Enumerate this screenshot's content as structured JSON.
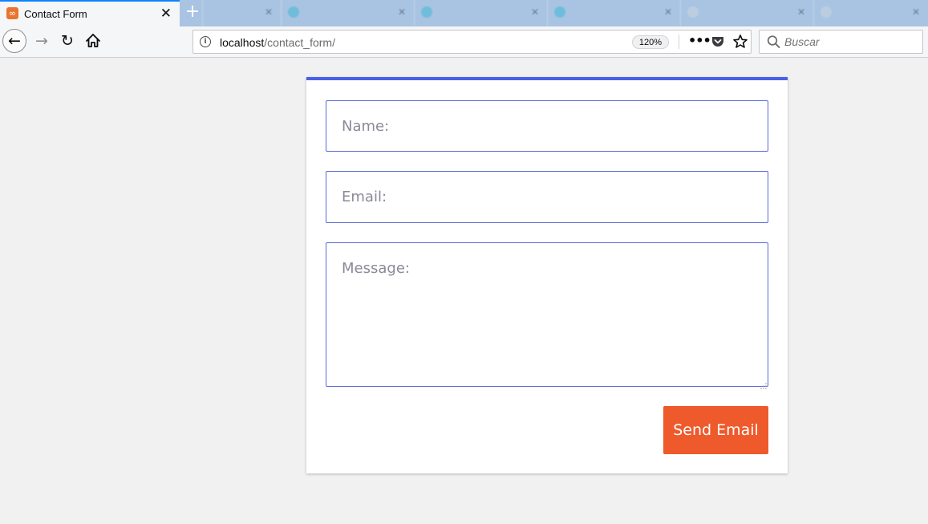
{
  "browser": {
    "active_tab": {
      "title": "Contact Form",
      "favicon": "xampp-icon"
    },
    "new_tab_icon": "plus-icon",
    "close_icon": "close-icon",
    "url": {
      "host": "localhost",
      "path": "/contact_form/"
    },
    "zoom": "120%",
    "search": {
      "placeholder": "Buscar"
    },
    "tab_strip_color": "#a9c4e2",
    "active_tab_accent": "#0a84ff"
  },
  "form": {
    "name_placeholder": "Name:",
    "email_placeholder": "Email:",
    "message_placeholder": "Message:",
    "submit_label": "Send Email",
    "accent_color": "#4a60e8",
    "button_color": "#ee5a2c"
  }
}
